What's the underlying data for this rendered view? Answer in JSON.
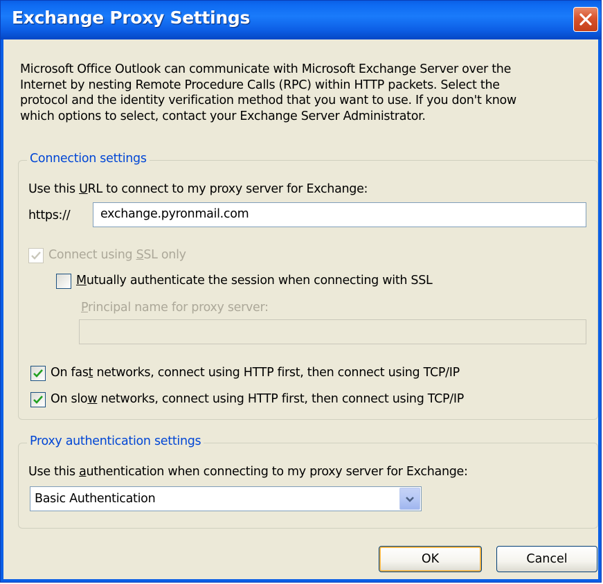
{
  "window": {
    "title": "Exchange Proxy Settings"
  },
  "intro": {
    "line1": "Microsoft Office Outlook can communicate with Microsoft Exchange Server over the",
    "line2": "Internet by nesting Remote Procedure Calls (RPC) within HTTP packets.  Select the",
    "line3": "protocol and the identity verification method that you want to use.  If you don't know",
    "line4": "which options to select, contact your Exchange Server Administrator."
  },
  "connection": {
    "legend": "Connection settings",
    "url_label_pre": "Use this ",
    "url_label_key": "U",
    "url_label_post": "RL to connect to my proxy server for Exchange:",
    "url_prefix": "https://",
    "url_value": "exchange.pyronmail.com",
    "ssl_pre": "Connect using ",
    "ssl_key": "S",
    "ssl_post": "SL only",
    "ssl_checked": true,
    "ssl_enabled": false,
    "mutual_key": "M",
    "mutual_post": "utually authenticate the session when connecting with SSL",
    "mutual_checked": false,
    "principal_key": "P",
    "principal_post": "rincipal name for proxy server:",
    "principal_value": "",
    "fast_pre": "On fas",
    "fast_key": "t",
    "fast_post": " networks, connect using HTTP first, then connect using TCP/IP",
    "fast_checked": true,
    "slow_pre": "On slo",
    "slow_key": "w",
    "slow_post": " networks, connect using HTTP first, then connect using TCP/IP",
    "slow_checked": true
  },
  "proxy_auth": {
    "legend": "Proxy authentication settings",
    "label_pre": "Use this ",
    "label_key": "a",
    "label_post": "uthentication when connecting to my proxy server for Exchange:",
    "selected": "Basic Authentication"
  },
  "buttons": {
    "ok": "OK",
    "cancel": "Cancel"
  },
  "colors": {
    "title_bar": "#0a5fe6",
    "legend": "#0046d5",
    "checkmark": "#21a121",
    "close": "#d8532c",
    "default_button_ring": "#f2b74b"
  }
}
